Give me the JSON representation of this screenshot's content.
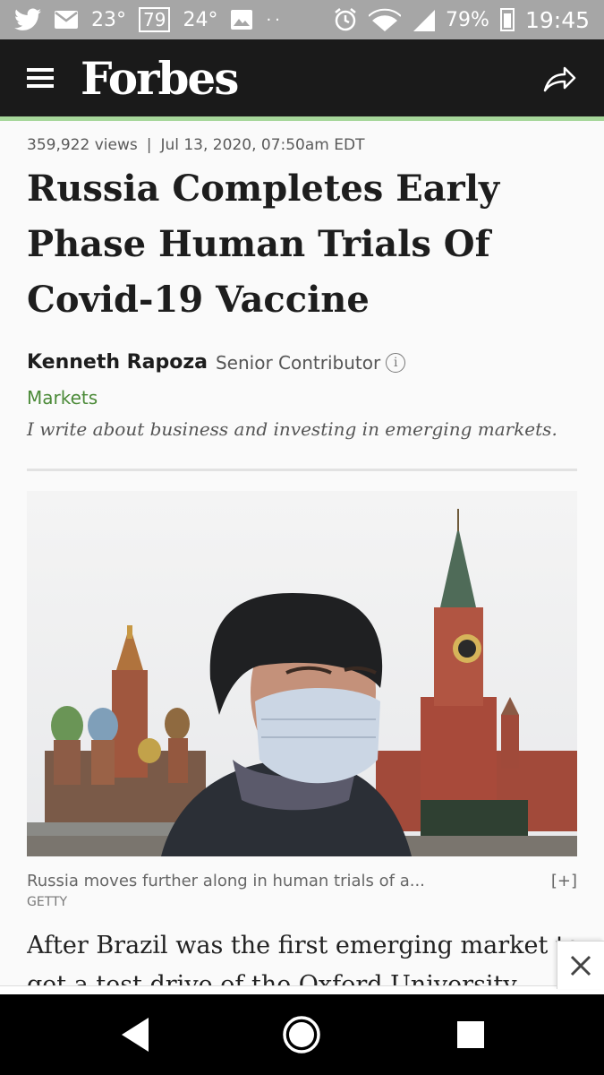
{
  "status_bar": {
    "weather_now": "23°",
    "badge_value": "79",
    "weather_high": "24°",
    "dots": "··",
    "battery": "79%",
    "time": "19:45"
  },
  "header": {
    "logo": "Forbes",
    "icons": [
      "menu-icon",
      "share-icon"
    ]
  },
  "article": {
    "views": "359,922 views",
    "separator": "|",
    "date": "Jul 13, 2020, 07:50am EDT",
    "title": "Russia Completes Early Phase Human Trials Of Covid-19 Vaccine",
    "author": "Kenneth Rapoza",
    "role": "Senior Contributor",
    "info_glyph": "i",
    "section": "Markets",
    "bio": "I write about business and investing in emerging markets.",
    "image": {
      "caption": "Russia moves further along in human trials of a...",
      "expand": "[+]",
      "credit": "GETTY"
    },
    "body_text": "After Brazil was the first emerging market to get a test drive of the Oxford University"
  },
  "colors": {
    "header_bg": "#1a1a1a",
    "accent_rule": "#a6d79a",
    "section_green": "#4b8a38",
    "status_bar_bg": "#a6a6a6"
  }
}
